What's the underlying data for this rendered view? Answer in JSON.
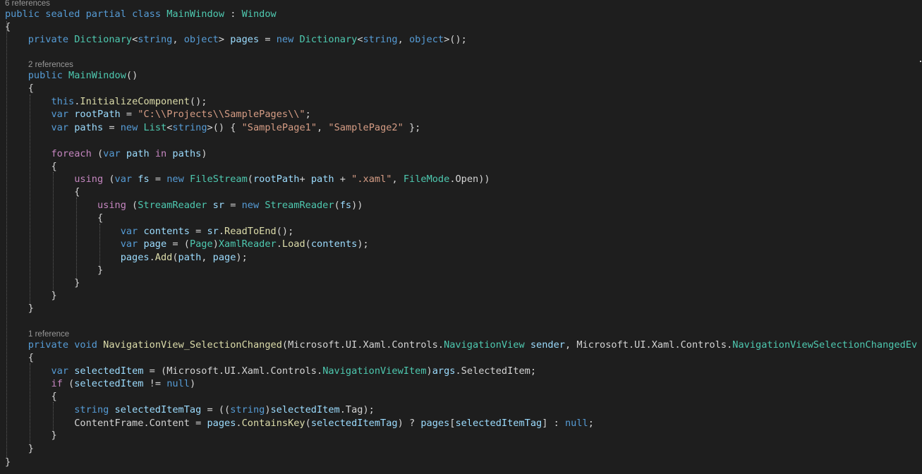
{
  "codelens": [
    {
      "text": "6 references"
    },
    {
      "text": "2 references"
    },
    {
      "text": "1 reference"
    }
  ],
  "colors": {
    "background": "#1e1e1e",
    "keyword": "#569cd6",
    "control_keyword": "#c586c0",
    "type": "#4ec9b0",
    "method": "#dcdcaa",
    "variable": "#9cdcfe",
    "string": "#d69d85",
    "default_text": "#d4d4d4",
    "codelens": "#999999"
  },
  "code_lines": [
    [
      [
        "kw",
        "public"
      ],
      [
        "p",
        " "
      ],
      [
        "kw",
        "sealed"
      ],
      [
        "p",
        " "
      ],
      [
        "kw",
        "partial"
      ],
      [
        "p",
        " "
      ],
      [
        "kw",
        "class"
      ],
      [
        "p",
        " "
      ],
      [
        "type",
        "MainWindow"
      ],
      [
        "p",
        " : "
      ],
      [
        "type",
        "Window"
      ]
    ],
    [
      [
        "p",
        "{"
      ]
    ],
    [
      [
        "p",
        "    "
      ],
      [
        "kw",
        "private"
      ],
      [
        "p",
        " "
      ],
      [
        "type",
        "Dictionary"
      ],
      [
        "p",
        "<"
      ],
      [
        "kw",
        "string"
      ],
      [
        "p",
        ", "
      ],
      [
        "kw",
        "object"
      ],
      [
        "p",
        "> "
      ],
      [
        "var",
        "pages"
      ],
      [
        "p",
        " = "
      ],
      [
        "kw",
        "new"
      ],
      [
        "p",
        " "
      ],
      [
        "type",
        "Dictionary"
      ],
      [
        "p",
        "<"
      ],
      [
        "kw",
        "string"
      ],
      [
        "p",
        ", "
      ],
      [
        "kw",
        "object"
      ],
      [
        "p",
        ">();"
      ]
    ],
    [
      [
        "p",
        "    "
      ],
      [
        "kw",
        "public"
      ],
      [
        "p",
        " "
      ],
      [
        "type",
        "MainWindow"
      ],
      [
        "p",
        "()"
      ]
    ],
    [
      [
        "p",
        "    {"
      ]
    ],
    [
      [
        "p",
        "        "
      ],
      [
        "kw",
        "this"
      ],
      [
        "p",
        "."
      ],
      [
        "method",
        "InitializeComponent"
      ],
      [
        "p",
        "();"
      ]
    ],
    [
      [
        "p",
        "        "
      ],
      [
        "kw",
        "var"
      ],
      [
        "p",
        " "
      ],
      [
        "var",
        "rootPath"
      ],
      [
        "p",
        " = "
      ],
      [
        "str",
        "\"C:\\\\Projects\\\\SamplePages\\\\\""
      ],
      [
        "p",
        ";"
      ]
    ],
    [
      [
        "p",
        "        "
      ],
      [
        "kw",
        "var"
      ],
      [
        "p",
        " "
      ],
      [
        "var",
        "paths"
      ],
      [
        "p",
        " = "
      ],
      [
        "kw",
        "new"
      ],
      [
        "p",
        " "
      ],
      [
        "type",
        "List"
      ],
      [
        "p",
        "<"
      ],
      [
        "kw",
        "string"
      ],
      [
        "p",
        ">() { "
      ],
      [
        "str",
        "\"SamplePage1\""
      ],
      [
        "p",
        ", "
      ],
      [
        "str",
        "\"SamplePage2\""
      ],
      [
        "p",
        " };"
      ]
    ],
    [
      [
        "p",
        "        "
      ],
      [
        "ctrl",
        "foreach"
      ],
      [
        "p",
        " ("
      ],
      [
        "kw",
        "var"
      ],
      [
        "p",
        " "
      ],
      [
        "var",
        "path"
      ],
      [
        "p",
        " "
      ],
      [
        "ctrl",
        "in"
      ],
      [
        "p",
        " "
      ],
      [
        "var",
        "paths"
      ],
      [
        "p",
        ")"
      ]
    ],
    [
      [
        "p",
        "        {"
      ]
    ],
    [
      [
        "p",
        "            "
      ],
      [
        "ctrl",
        "using"
      ],
      [
        "p",
        " ("
      ],
      [
        "kw",
        "var"
      ],
      [
        "p",
        " "
      ],
      [
        "var",
        "fs"
      ],
      [
        "p",
        " = "
      ],
      [
        "kw",
        "new"
      ],
      [
        "p",
        " "
      ],
      [
        "type",
        "FileStream"
      ],
      [
        "p",
        "("
      ],
      [
        "var",
        "rootPath"
      ],
      [
        "p",
        "+ "
      ],
      [
        "var",
        "path"
      ],
      [
        "p",
        " + "
      ],
      [
        "str",
        "\".xaml\""
      ],
      [
        "p",
        ", "
      ],
      [
        "type",
        "FileMode"
      ],
      [
        "p",
        "."
      ],
      [
        "plain",
        "Open"
      ],
      [
        "p",
        "))"
      ]
    ],
    [
      [
        "p",
        "            {"
      ]
    ],
    [
      [
        "p",
        "                "
      ],
      [
        "ctrl",
        "using"
      ],
      [
        "p",
        " ("
      ],
      [
        "type",
        "StreamReader"
      ],
      [
        "p",
        " "
      ],
      [
        "var",
        "sr"
      ],
      [
        "p",
        " = "
      ],
      [
        "kw",
        "new"
      ],
      [
        "p",
        " "
      ],
      [
        "type",
        "StreamReader"
      ],
      [
        "p",
        "("
      ],
      [
        "var",
        "fs"
      ],
      [
        "p",
        "))"
      ]
    ],
    [
      [
        "p",
        "                {"
      ]
    ],
    [
      [
        "p",
        "                    "
      ],
      [
        "kw",
        "var"
      ],
      [
        "p",
        " "
      ],
      [
        "var",
        "contents"
      ],
      [
        "p",
        " = "
      ],
      [
        "var",
        "sr"
      ],
      [
        "p",
        "."
      ],
      [
        "method",
        "ReadToEnd"
      ],
      [
        "p",
        "();"
      ]
    ],
    [
      [
        "p",
        "                    "
      ],
      [
        "kw",
        "var"
      ],
      [
        "p",
        " "
      ],
      [
        "var",
        "page"
      ],
      [
        "p",
        " = ("
      ],
      [
        "type",
        "Page"
      ],
      [
        "p",
        ")"
      ],
      [
        "type",
        "XamlReader"
      ],
      [
        "p",
        "."
      ],
      [
        "method",
        "Load"
      ],
      [
        "p",
        "("
      ],
      [
        "var",
        "contents"
      ],
      [
        "p",
        ");"
      ]
    ],
    [
      [
        "p",
        "                    "
      ],
      [
        "var",
        "pages"
      ],
      [
        "p",
        "."
      ],
      [
        "method",
        "Add"
      ],
      [
        "p",
        "("
      ],
      [
        "var",
        "path"
      ],
      [
        "p",
        ", "
      ],
      [
        "var",
        "page"
      ],
      [
        "p",
        ");"
      ]
    ],
    [
      [
        "p",
        "                }"
      ]
    ],
    [
      [
        "p",
        "            }"
      ]
    ],
    [
      [
        "p",
        "        }"
      ]
    ],
    [
      [
        "p",
        "    }"
      ]
    ],
    [
      [
        "p",
        "    "
      ],
      [
        "kw",
        "private"
      ],
      [
        "p",
        " "
      ],
      [
        "kw",
        "void"
      ],
      [
        "p",
        " "
      ],
      [
        "method",
        "NavigationView_SelectionChanged"
      ],
      [
        "p",
        "("
      ],
      [
        "ns",
        "Microsoft.UI.Xaml.Controls."
      ],
      [
        "type",
        "NavigationView"
      ],
      [
        "p",
        " "
      ],
      [
        "var",
        "sender"
      ],
      [
        "p",
        ", "
      ],
      [
        "ns",
        "Microsoft.UI.Xaml.Controls."
      ],
      [
        "type",
        "NavigationViewSelectionChangedEv"
      ]
    ],
    [
      [
        "p",
        "    {"
      ]
    ],
    [
      [
        "p",
        "        "
      ],
      [
        "kw",
        "var"
      ],
      [
        "p",
        " "
      ],
      [
        "var",
        "selectedItem"
      ],
      [
        "p",
        " = ("
      ],
      [
        "ns",
        "Microsoft.UI.Xaml.Controls."
      ],
      [
        "type",
        "NavigationViewItem"
      ],
      [
        "p",
        ")"
      ],
      [
        "var",
        "args"
      ],
      [
        "p",
        "."
      ],
      [
        "plain",
        "SelectedItem"
      ],
      [
        "p",
        ";"
      ]
    ],
    [
      [
        "p",
        "        "
      ],
      [
        "ctrl",
        "if"
      ],
      [
        "p",
        " ("
      ],
      [
        "var",
        "selectedItem"
      ],
      [
        "p",
        " != "
      ],
      [
        "kw",
        "null"
      ],
      [
        "p",
        ")"
      ]
    ],
    [
      [
        "p",
        "        {"
      ]
    ],
    [
      [
        "p",
        "            "
      ],
      [
        "kw",
        "string"
      ],
      [
        "p",
        " "
      ],
      [
        "var",
        "selectedItemTag"
      ],
      [
        "p",
        " = (("
      ],
      [
        "kw",
        "string"
      ],
      [
        "p",
        ")"
      ],
      [
        "var",
        "selectedItem"
      ],
      [
        "p",
        "."
      ],
      [
        "plain",
        "Tag"
      ],
      [
        "p",
        ");"
      ]
    ],
    [
      [
        "p",
        "            "
      ],
      [
        "plain",
        "ContentFrame"
      ],
      [
        "p",
        "."
      ],
      [
        "plain",
        "Content"
      ],
      [
        "p",
        " = "
      ],
      [
        "var",
        "pages"
      ],
      [
        "p",
        "."
      ],
      [
        "method",
        "ContainsKey"
      ],
      [
        "p",
        "("
      ],
      [
        "var",
        "selectedItemTag"
      ],
      [
        "p",
        ") ? "
      ],
      [
        "var",
        "pages"
      ],
      [
        "p",
        "["
      ],
      [
        "var",
        "selectedItemTag"
      ],
      [
        "p",
        "] : "
      ],
      [
        "kw",
        "null"
      ],
      [
        "p",
        ";"
      ]
    ],
    [
      [
        "p",
        "        }"
      ]
    ],
    [
      [
        "p",
        "    }"
      ]
    ],
    [
      [
        "p",
        "}"
      ]
    ]
  ]
}
